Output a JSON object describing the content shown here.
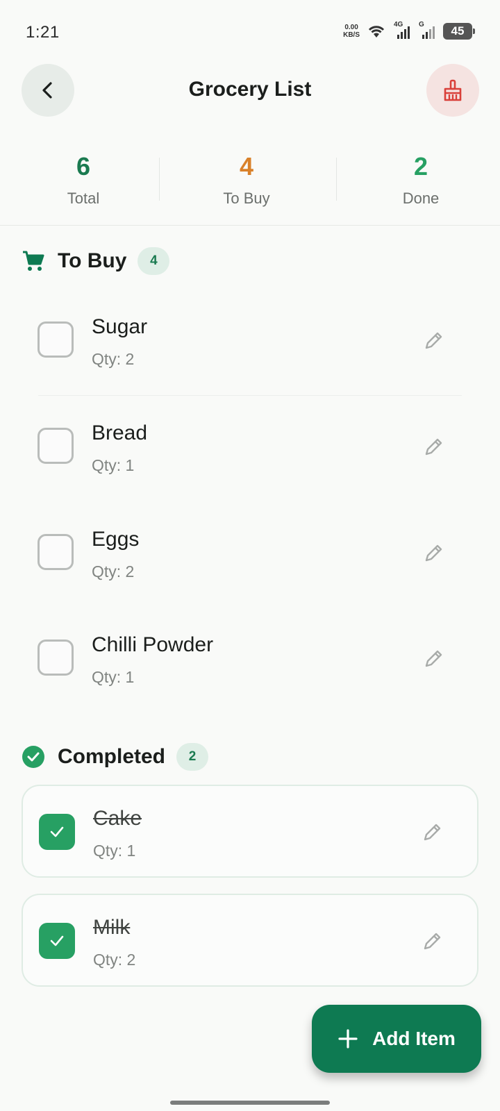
{
  "status_bar": {
    "time": "1:21",
    "net_speed_value": "0.00",
    "net_speed_unit": "KB/S",
    "signal1_label": "4G",
    "signal2_label": "G",
    "battery": "45"
  },
  "header": {
    "title": "Grocery List",
    "back_icon": "chevron-left-icon",
    "clear_icon": "broom-icon"
  },
  "stats": [
    {
      "value": "6",
      "label": "Total",
      "color": "#1a7a50"
    },
    {
      "value": "4",
      "label": "To Buy",
      "color": "#d9812a"
    },
    {
      "value": "2",
      "label": "Done",
      "color": "#27a063"
    }
  ],
  "to_buy": {
    "title": "To Buy",
    "count": "4",
    "icon": "cart-icon",
    "items": [
      {
        "name": "Sugar",
        "qty": "Qty: 2"
      },
      {
        "name": "Bread",
        "qty": "Qty: 1"
      },
      {
        "name": "Eggs",
        "qty": "Qty: 2"
      },
      {
        "name": "Chilli Powder",
        "qty": "Qty: 1"
      }
    ]
  },
  "completed": {
    "title": "Completed",
    "count": "2",
    "icon": "check-circle-icon",
    "items": [
      {
        "name": "Cake",
        "qty": "Qty: 1"
      },
      {
        "name": "Milk",
        "qty": "Qty: 2"
      }
    ]
  },
  "fab": {
    "label": "Add Item",
    "icon": "plus-icon"
  },
  "colors": {
    "brand": "#0e7a52",
    "accent_green": "#27a063",
    "danger": "#d9403a"
  }
}
